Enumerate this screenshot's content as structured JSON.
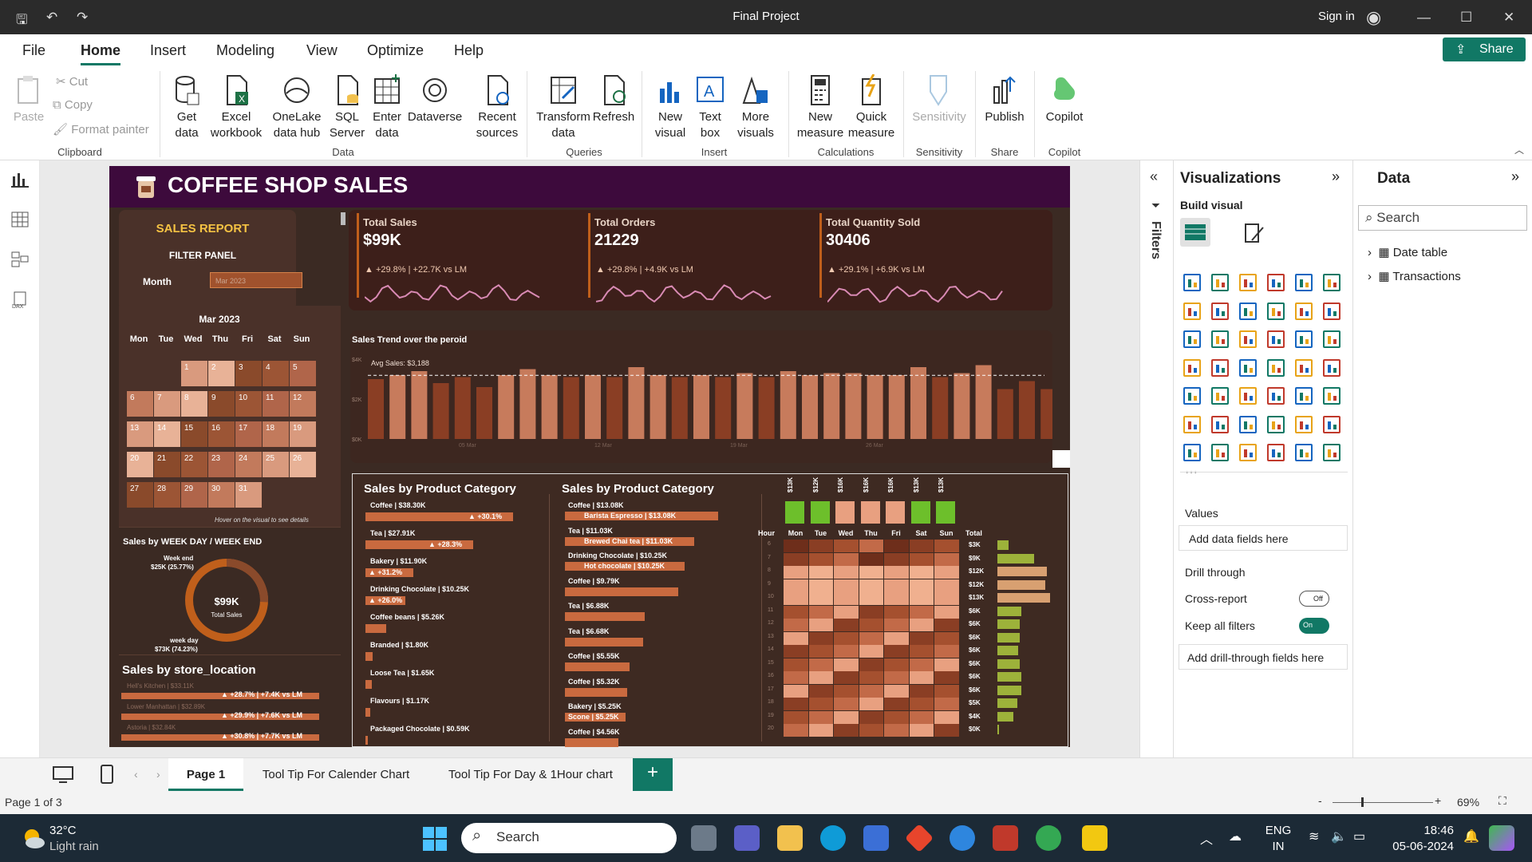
{
  "window": {
    "title": "Final Project",
    "sign_in": "Sign in"
  },
  "menu": [
    "File",
    "Home",
    "Insert",
    "Modeling",
    "View",
    "Optimize",
    "Help"
  ],
  "share_label": "Share",
  "ribbon": {
    "clipboard": {
      "paste": "Paste",
      "cut": "Cut",
      "copy": "Copy",
      "format_painter": "Format painter",
      "group": "Clipboard"
    },
    "data": {
      "get_data": "Get data",
      "excel": "Excel workbook",
      "onelake": "OneLake data hub",
      "sql": "SQL Server",
      "enter": "Enter data",
      "dataverse": "Dataverse",
      "recent": "Recent sources",
      "group": "Data"
    },
    "queries": {
      "transform": "Transform data",
      "refresh": "Refresh",
      "group": "Queries"
    },
    "insert": {
      "new_visual": "New visual",
      "text_box": "Text box",
      "more_visuals": "More visuals",
      "group": "Insert"
    },
    "calculations": {
      "new_measure": "New measure",
      "quick_measure": "Quick measure",
      "group": "Calculations"
    },
    "sensitivity": {
      "label": "Sensitivity",
      "group": "Sensitivity"
    },
    "share": {
      "publish": "Publish",
      "group": "Share"
    },
    "copilot": {
      "label": "Copilot",
      "group": "Copilot"
    }
  },
  "report": {
    "title": "COFFEE SHOP SALES",
    "sales_report": "SALES REPORT",
    "filter_panel": "FILTER PANEL",
    "month_label": "Month",
    "month_value": "Mar 2023",
    "calendar": {
      "title": "Mar 2023",
      "days": [
        "Mon",
        "Tue",
        "Wed",
        "Thu",
        "Fri",
        "Sat",
        "Sun"
      ],
      "hint": "Hover on the visual to see details"
    },
    "kpis": [
      {
        "title": "Total Sales",
        "value": "$99K",
        "delta": "▲ +29.8% | +22.7K vs LM"
      },
      {
        "title": "Total Orders",
        "value": "21229",
        "delta": "▲ +29.8% | +4.9K vs LM"
      },
      {
        "title": "Total Quantity Sold",
        "value": "30406",
        "delta": "▲ +29.1% | +6.9K vs LM"
      }
    ],
    "trend": {
      "title": "Sales Trend over the peroid",
      "avg": "Avg Sales: $3,188",
      "y_ticks": [
        "$4K",
        "$2K",
        "$0K"
      ],
      "x_ticks": [
        "05 Mar",
        "12 Mar",
        "19 Mar",
        "26 Mar"
      ]
    },
    "donut": {
      "title": "Sales by WEEK DAY / WEEK END",
      "center_value": "$99K",
      "center_label": "Total Sales",
      "weekend_label": "Week end",
      "weekend_value": "$25K (25.77%)",
      "weekday_label": "week day",
      "weekday_value": "$73K (74.23%)"
    },
    "store": {
      "title": "Sales by store_location",
      "rows": [
        {
          "name": "Hell's Kitchen | $33.11K",
          "delta": "▲ +28.7% | +7.4K vs LM"
        },
        {
          "name": "Lower Manhattan | $32.89K",
          "delta": "▲ +29.9% | +7.6K vs LM"
        },
        {
          "name": "Astoria | $32.84K",
          "delta": "▲ +30.8% | +7.7K vs LM"
        }
      ]
    },
    "category1": {
      "title": "Sales by Product Category",
      "rows": [
        {
          "label": "Coffee | $38.30K",
          "delta": "▲ +30.1%"
        },
        {
          "label": "Tea | $27.91K",
          "delta": "▲ +28.3%"
        },
        {
          "label": "Bakery | $11.90K",
          "delta": "▲ +31.2%"
        },
        {
          "label": "Drinking Chocolate | $10.25K",
          "delta": "▲ +26.0%"
        },
        {
          "label": "Coffee beans | $5.26K",
          "delta": ""
        },
        {
          "label": "Branded | $1.80K",
          "delta": ""
        },
        {
          "label": "Loose Tea | $1.65K",
          "delta": ""
        },
        {
          "label": "Flavours | $1.17K",
          "delta": ""
        },
        {
          "label": "Packaged Chocolate | $0.59K",
          "delta": ""
        }
      ]
    },
    "category2": {
      "title": "Sales by Product Category",
      "rows": [
        {
          "label": "Coffee | $13.08K",
          "sub": "Barista Espresso | $13.08K"
        },
        {
          "label": "Tea | $11.03K",
          "sub": "Brewed Chai tea | $11.03K"
        },
        {
          "label": "Drinking Chocolate | $10.25K",
          "sub": "Hot chocolate | $10.25K"
        },
        {
          "label": "Coffee | $9.79K",
          "sub": ""
        },
        {
          "label": "Tea | $6.88K",
          "sub": ""
        },
        {
          "label": "Tea | $6.68K",
          "sub": ""
        },
        {
          "label": "Coffee | $5.55K",
          "sub": ""
        },
        {
          "label": "Coffee | $5.32K",
          "sub": ""
        },
        {
          "label": "Bakery | $5.25K",
          "sub": "Scone | $5.25K"
        },
        {
          "label": "Coffee | $4.56K",
          "sub": ""
        }
      ]
    },
    "heatmap": {
      "day_totals": [
        "$13K",
        "$12K",
        "$16K",
        "$16K",
        "$16K",
        "$13K",
        "$13K"
      ],
      "days": [
        "Mon",
        "Tue",
        "Wed",
        "Thu",
        "Fri",
        "Sat",
        "Sun"
      ],
      "hour_label": "Hour",
      "total_label": "Total",
      "hours": [
        "6",
        "7",
        "8",
        "9",
        "10",
        "11",
        "12",
        "13",
        "14",
        "15",
        "16",
        "17",
        "18",
        "19",
        "20"
      ],
      "hour_totals": [
        "$3K",
        "$9K",
        "$12K",
        "$12K",
        "$13K",
        "$6K",
        "$6K",
        "$6K",
        "$6K",
        "$6K",
        "$6K",
        "$6K",
        "$5K",
        "$4K",
        "$0K"
      ]
    }
  },
  "viz_pane": {
    "title": "Visualizations",
    "build": "Build visual",
    "values": "Values",
    "add_fields": "Add data fields here",
    "drill": "Drill through",
    "cross": "Cross-report",
    "cross_state": "Off",
    "keep": "Keep all filters",
    "keep_state": "On",
    "add_drill": "Add drill-through fields here"
  },
  "data_pane": {
    "title": "Data",
    "search": "Search",
    "tables": [
      "Date table",
      "Transactions"
    ]
  },
  "filters_label": "Filters",
  "tabs": [
    "Page 1",
    "Tool Tip For Calender Chart",
    "Tool Tip For Day & 1Hour chart"
  ],
  "status": {
    "page": "Page 1 of 3",
    "zoom": "69%"
  },
  "taskbar": {
    "temp": "32°C",
    "weather": "Light rain",
    "search": "Search",
    "lang1": "ENG",
    "lang2": "IN",
    "time": "18:46",
    "date": "05-06-2024"
  }
}
